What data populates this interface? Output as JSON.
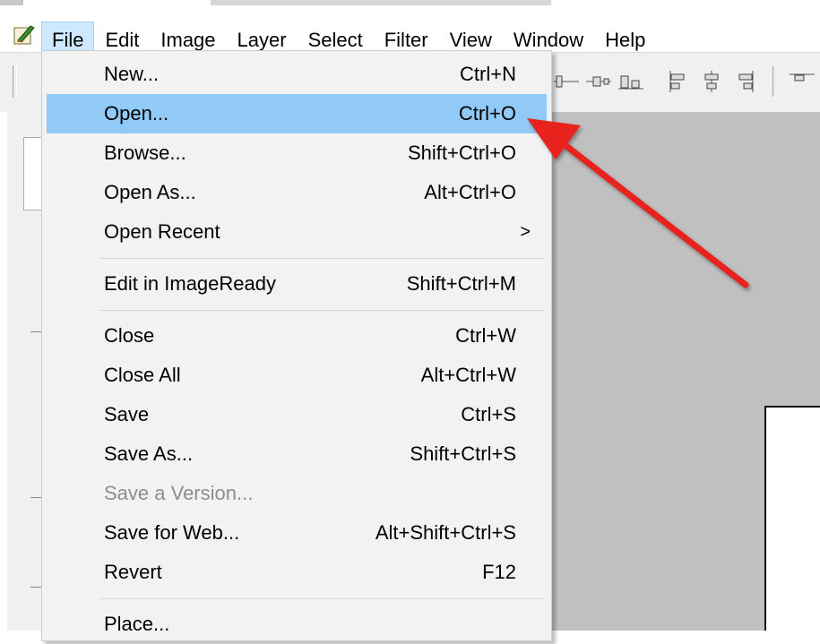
{
  "menubar": {
    "items": [
      {
        "label": "File"
      },
      {
        "label": "Edit"
      },
      {
        "label": "Image"
      },
      {
        "label": "Layer"
      },
      {
        "label": "Select"
      },
      {
        "label": "Filter"
      },
      {
        "label": "View"
      },
      {
        "label": "Window"
      },
      {
        "label": "Help"
      }
    ],
    "active": "File"
  },
  "file_menu": {
    "items": [
      {
        "label": "New...",
        "shortcut": "Ctrl+N"
      },
      {
        "label": "Open...",
        "shortcut": "Ctrl+O",
        "highlighted": true
      },
      {
        "label": "Browse...",
        "shortcut": "Shift+Ctrl+O"
      },
      {
        "label": "Open As...",
        "shortcut": "Alt+Ctrl+O"
      },
      {
        "label": "Open Recent",
        "shortcut": "",
        "submenu": true,
        "arrow": ">"
      },
      {
        "label": "Edit in ImageReady",
        "shortcut": "Shift+Ctrl+M"
      },
      {
        "label": "Close",
        "shortcut": "Ctrl+W"
      },
      {
        "label": "Close All",
        "shortcut": "Alt+Ctrl+W"
      },
      {
        "label": "Save",
        "shortcut": "Ctrl+S"
      },
      {
        "label": "Save As...",
        "shortcut": "Shift+Ctrl+S"
      },
      {
        "label": "Save a Version...",
        "shortcut": "",
        "disabled": true
      },
      {
        "label": "Save for Web...",
        "shortcut": "Alt+Shift+Ctrl+S"
      },
      {
        "label": "Revert",
        "shortcut": "F12"
      },
      {
        "label": "Place...",
        "shortcut": ""
      }
    ]
  },
  "colors": {
    "highlight": "#91c9f7",
    "menu_active_bg": "#cde8ff",
    "arrow": "#e8211b",
    "workspace_bg": "#c0c0c0"
  },
  "icons": {
    "app": "photoshop-feather-icon",
    "toolbar": [
      "align-center-icon",
      "distribute-icon",
      "align-bottom-icon",
      "align-left-icon",
      "align-vcenter-icon",
      "align-right-icon",
      "distribute-top-icon"
    ]
  }
}
